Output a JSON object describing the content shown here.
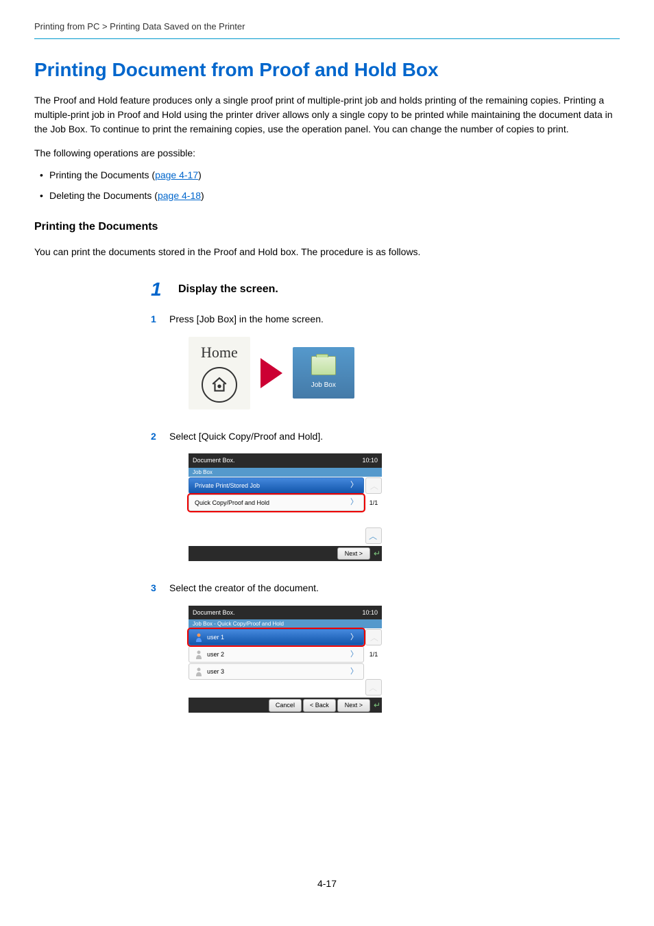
{
  "breadcrumb": "Printing from PC > Printing Data Saved on the Printer",
  "title": "Printing Document from Proof and Hold Box",
  "intro": "The Proof and Hold feature produces only a single proof print of multiple-print job and holds printing of the remaining copies. Printing a multiple-print job in Proof and Hold using the printer driver allows only a single copy to be printed while maintaining the document data in the Job Box. To continue to print the remaining copies, use the operation panel. You can change the number of copies to print.",
  "opsIntro": "The following operations are possible:",
  "bullets": [
    {
      "text": "Printing the Documents (",
      "link": "page 4-17",
      "suffix": ")"
    },
    {
      "text": "Deleting the Documents (",
      "link": "page 4-18",
      "suffix": ")"
    }
  ],
  "subheading": "Printing the Documents",
  "subtext": "You can print the documents stored in the Proof and Hold box. The procedure is as follows.",
  "step1": {
    "num": "1",
    "title": "Display the screen.",
    "sub1": {
      "num": "1",
      "text": "Press [Job Box] in the home screen."
    },
    "home": {
      "label": "Home",
      "tile": "Job Box"
    },
    "sub2": {
      "num": "2",
      "text": "Select [Quick Copy/Proof and Hold]."
    },
    "panel1": {
      "title": "Document Box.",
      "time": "10:10",
      "subtitle": "Job Box",
      "rows": [
        {
          "label": "Private Print/Stored Job",
          "selected": true
        },
        {
          "label": "Quick Copy/Proof and Hold",
          "highlighted": true
        }
      ],
      "page": "1/1",
      "next": "Next >"
    },
    "sub3": {
      "num": "3",
      "text": "Select the creator of the document."
    },
    "panel2": {
      "title": "Document Box.",
      "time": "10:10",
      "subtitle": "Job Box - Quick Copy/Proof and Hold",
      "rows": [
        {
          "label": "user 1",
          "selected": true,
          "highlighted": true
        },
        {
          "label": "user 2"
        },
        {
          "label": "user 3"
        }
      ],
      "page": "1/1",
      "cancel": "Cancel",
      "back": "< Back",
      "next": "Next >"
    }
  },
  "pagenum": "4-17"
}
